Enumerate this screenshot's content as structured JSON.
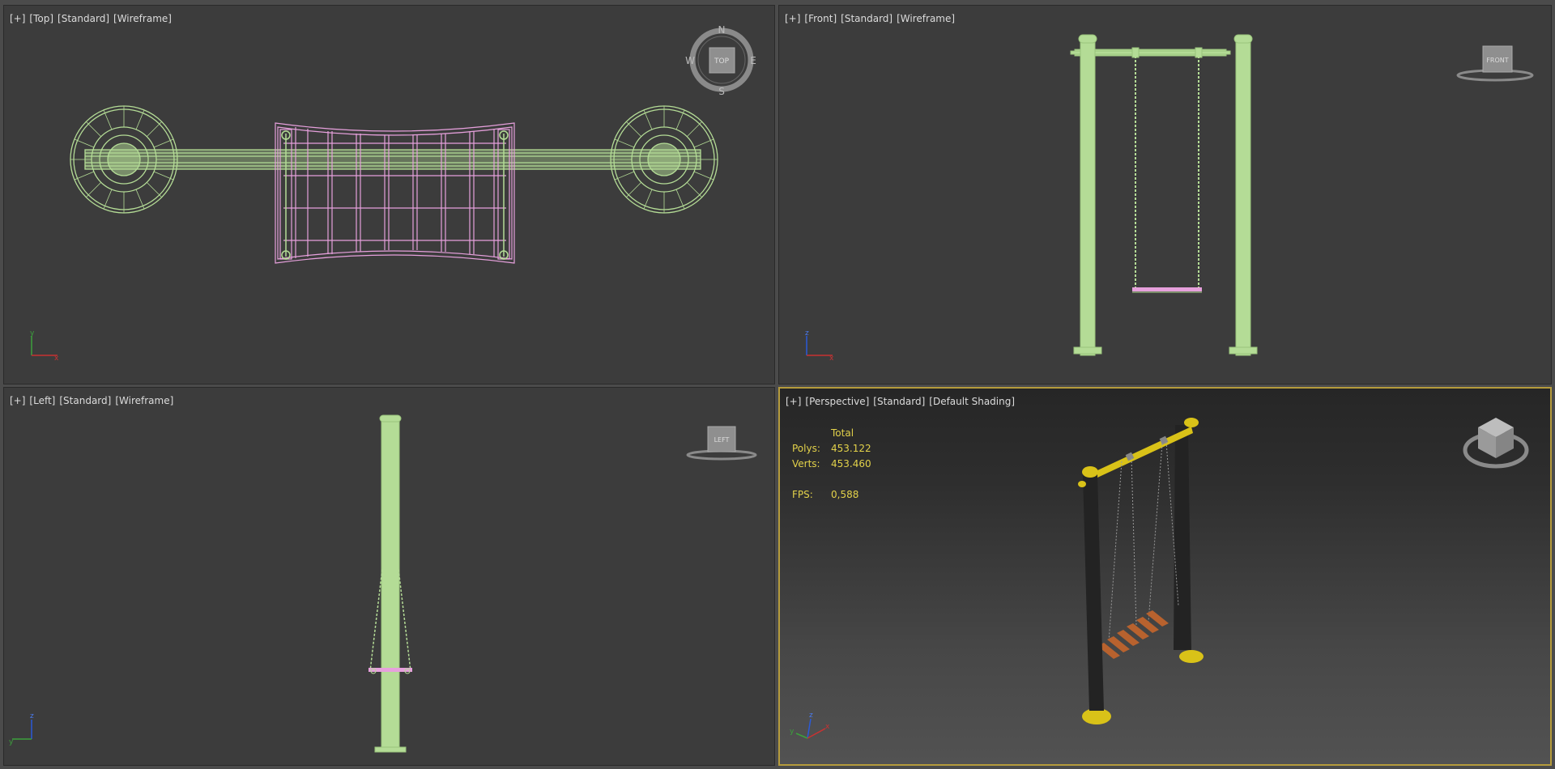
{
  "viewports": {
    "top": {
      "labels": [
        "[+]",
        "[Top]",
        "[Standard]",
        "[Wireframe]"
      ],
      "compass": {
        "n": "N",
        "s": "S",
        "e": "E",
        "w": "W",
        "cube": "TOP"
      },
      "axes": {
        "vertical": "y",
        "horizontal": "x"
      }
    },
    "front": {
      "labels": [
        "[+]",
        "[Front]",
        "[Standard]",
        "[Wireframe]"
      ],
      "cube": "FRONT",
      "axes": {
        "vertical": "z",
        "horizontal": "x"
      }
    },
    "left": {
      "labels": [
        "[+]",
        "[Left]",
        "[Standard]",
        "[Wireframe]"
      ],
      "cube": "LEFT",
      "axes": {
        "vertical": "z",
        "horizontal": "y"
      }
    },
    "perspective": {
      "labels": [
        "[+]",
        "[Perspective]",
        "[Standard]",
        "[Default Shading]"
      ],
      "axes": {
        "vertical": "z",
        "horizontal": "x",
        "depth": "y"
      },
      "stats": {
        "header": "Total",
        "polys_label": "Polys:",
        "polys": "453.122",
        "verts_label": "Verts:",
        "verts": "453.460",
        "fps_label": "FPS:",
        "fps": "0,588"
      }
    }
  },
  "colors": {
    "wire_green": "#b4dc96",
    "wire_pink": "#e6a0dc",
    "post_dark": "#232323",
    "cap_yellow": "#d9c218",
    "seat_wood": "#b8622e",
    "active_border": "#b59b3c"
  }
}
